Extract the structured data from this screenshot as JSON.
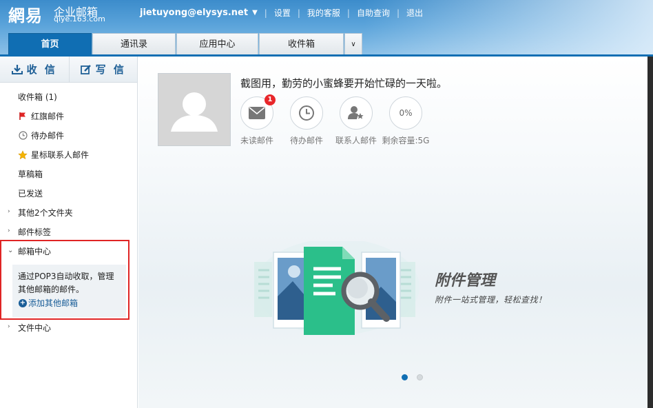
{
  "header": {
    "logo_main": "網易",
    "logo_sub": "企业邮箱",
    "logo_domain": "qiye.163.com",
    "user": "jietuyong@elysys.net",
    "links": [
      "设置",
      "我的客服",
      "自助查询",
      "退出"
    ]
  },
  "tabs": [
    "首页",
    "通讯录",
    "应用中心",
    "收件箱"
  ],
  "sidebar": {
    "receive": "收 信",
    "write": "写 信",
    "inbox": "收件箱 (1)",
    "flagged": "红旗邮件",
    "todo": "待办邮件",
    "starred": "星标联系人邮件",
    "drafts": "草稿箱",
    "sent": "已发送",
    "other_folders": "其他2个文件夹",
    "tags": "邮件标签",
    "mail_center": "邮箱中心",
    "mail_center_desc_1": "通过POP3自动收取，管理",
    "mail_center_desc_2": "其他邮箱的邮件。",
    "add_other": "添加其他邮箱",
    "file_center": "文件中心"
  },
  "main": {
    "greeting": "截图用，勤劳的小蜜蜂要开始忙碌的一天啦。",
    "stats": {
      "unread": {
        "label": "未读邮件",
        "badge": "1"
      },
      "todo": {
        "label": "待办邮件"
      },
      "contacts": {
        "label": "联系人邮件"
      },
      "capacity": {
        "label": "剩余容量:5G",
        "value": "0%"
      }
    },
    "feature_title": "附件管理",
    "feature_sub": "附件一站式管理，轻松查找！",
    "carousel_active": 0
  },
  "colors": {
    "brand": "#106eb3",
    "accent_red": "#e02424",
    "green": "#2bbf8a"
  }
}
